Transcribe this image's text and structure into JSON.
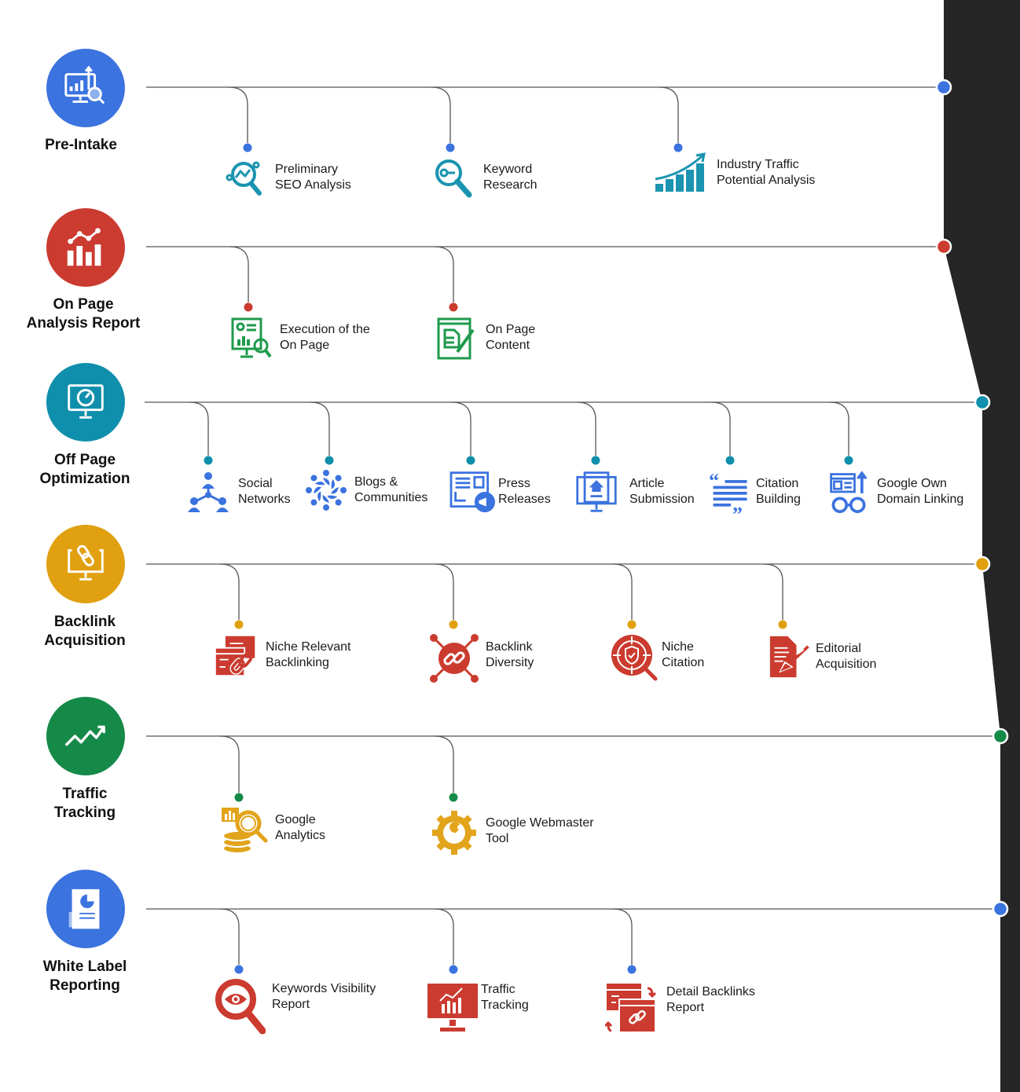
{
  "colors": {
    "blue": "#3b73df",
    "red": "#cb3b2f",
    "teal": "#0f8fab",
    "gold": "#e0a010",
    "green": "#158a48",
    "dark_band": "#262626",
    "line": "#555555",
    "icon_teal": "#1a94b0",
    "icon_green": "#1f9a4c",
    "icon_blue": "#3b73df",
    "icon_red": "#cb3b2f",
    "icon_gold": "#e2a41a"
  },
  "stages": [
    {
      "id": "pre-intake",
      "title": "Pre-Intake",
      "color": "blue",
      "icon": "monitor-chart-magnifier-icon",
      "items": [
        {
          "label": "Preliminary\nSEO Analysis",
          "icon": "magnifier-graph-icon",
          "icon_color": "icon_teal"
        },
        {
          "label": "Keyword\nResearch",
          "icon": "key-magnifier-icon",
          "icon_color": "icon_teal"
        },
        {
          "label": "Industry Traffic\nPotential Analysis",
          "icon": "growth-bars-icon",
          "icon_color": "icon_teal"
        }
      ]
    },
    {
      "id": "on-page",
      "title": "On Page\nAnalysis Report",
      "color": "red",
      "icon": "bar-line-chart-icon",
      "items": [
        {
          "label": "Execution of the\nOn Page",
          "icon": "report-monitor-magnifier-icon",
          "icon_color": "icon_green"
        },
        {
          "label": "On Page\nContent",
          "icon": "document-pencil-icon",
          "icon_color": "icon_green"
        }
      ]
    },
    {
      "id": "off-page",
      "title": "Off Page\nOptimization",
      "color": "teal",
      "icon": "monitor-speedometer-icon",
      "items": [
        {
          "label": "Social\nNetworks",
          "icon": "people-network-icon",
          "icon_color": "icon_blue"
        },
        {
          "label": "Blogs &\nCommunities",
          "icon": "community-circle-icon",
          "icon_color": "icon_blue"
        },
        {
          "label": "Press\nReleases",
          "icon": "newspaper-megaphone-icon",
          "icon_color": "icon_blue"
        },
        {
          "label": "Article\nSubmission",
          "icon": "monitor-upload-icon",
          "icon_color": "icon_blue"
        },
        {
          "label": "Citation\nBuilding",
          "icon": "quote-lines-icon",
          "icon_color": "icon_blue"
        },
        {
          "label": "Google Own\nDomain Linking",
          "icon": "browser-link-arrow-icon",
          "icon_color": "icon_blue"
        }
      ]
    },
    {
      "id": "backlink",
      "title": "Backlink\nAcquisition",
      "color": "gold",
      "icon": "monitor-link-icon",
      "items": [
        {
          "label": "Niche Relevant\nBacklinking",
          "icon": "browser-windows-link-icon",
          "icon_color": "icon_red"
        },
        {
          "label": "Backlink\nDiversity",
          "icon": "link-hub-icon",
          "icon_color": "icon_red"
        },
        {
          "label": "Niche\nCitation",
          "icon": "target-shield-icon",
          "icon_color": "icon_red"
        },
        {
          "label": "Editorial\nAcquisition",
          "icon": "document-pen-icon",
          "icon_color": "icon_red"
        }
      ]
    },
    {
      "id": "traffic",
      "title": "Traffic\nTracking",
      "color": "green",
      "icon": "trend-arrow-icon",
      "items": [
        {
          "label": "Google\nAnalytics",
          "icon": "coins-magnifier-icon",
          "icon_color": "icon_gold"
        },
        {
          "label": "Google Webmaster\nTool",
          "icon": "gear-wrench-icon",
          "icon_color": "icon_gold"
        }
      ]
    },
    {
      "id": "reporting",
      "title": "White Label\nReporting",
      "color": "blue",
      "icon": "report-pie-icon",
      "items": [
        {
          "label": "Keywords Visibility\nReport",
          "icon": "eye-magnifier-icon",
          "icon_color": "icon_red"
        },
        {
          "label": "Traffic\nTracking",
          "icon": "monitor-growth-icon",
          "icon_color": "icon_red"
        },
        {
          "label": "Detail Backlinks\nReport",
          "icon": "browser-sync-link-icon",
          "icon_color": "icon_red"
        }
      ]
    }
  ]
}
